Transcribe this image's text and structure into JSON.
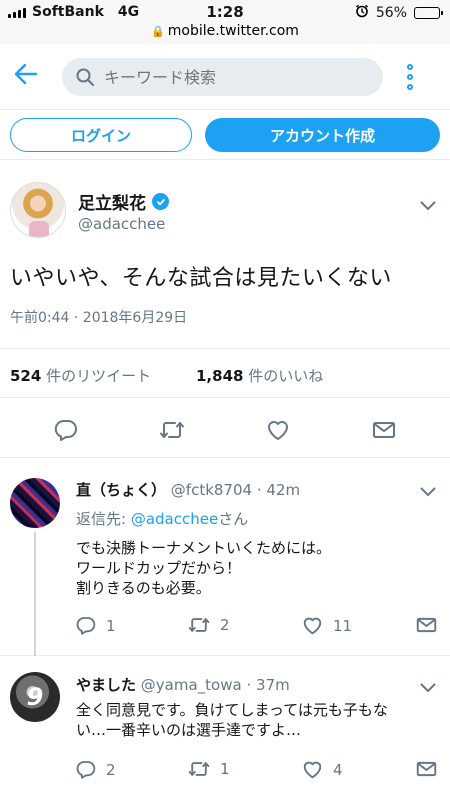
{
  "status_bar": {
    "carrier": "SoftBank",
    "network": "4G",
    "time": "1:28",
    "battery_percent": "56%",
    "battery_level": 0.56,
    "url": "mobile.twitter.com"
  },
  "header": {
    "search_placeholder": "キーワード検索"
  },
  "auth": {
    "login_label": "ログイン",
    "signup_label": "アカウント作成"
  },
  "main_tweet": {
    "name": "足立梨花",
    "handle": "@adacchee",
    "text": "いやいや、そんな試合は見たいくない",
    "timestamp": "午前0:44 · 2018年6月29日",
    "retweets_count": "524",
    "retweets_label": "件のリツイート",
    "likes_count": "1,848",
    "likes_label": "件のいいね"
  },
  "replies": [
    {
      "name": "直（ちょく）",
      "handle": "@fctk8704",
      "time": "· 42m",
      "reply_to_prefix": "返信先: ",
      "reply_to_handle": "@adacchee",
      "reply_to_suffix": "さん",
      "text_lines": [
        "でも決勝トーナメントいくためには。",
        "ワールドカップだから！",
        "割りきるのも必要。"
      ],
      "reply_count": "1",
      "retweet_count": "2",
      "like_count": "11"
    },
    {
      "name": "やました",
      "handle": "@yama_towa",
      "time": "· 37m",
      "avatar_text": "9",
      "text_lines": [
        "全く同意見です。負けてしまっては元も子もな",
        "い…一番辛いのは選手達ですよ…"
      ],
      "reply_count": "2",
      "retweet_count": "1",
      "like_count": "4"
    }
  ],
  "colors": {
    "accent": "#1da1f2",
    "secondary_text": "#657786",
    "border": "#e6ecf0"
  }
}
